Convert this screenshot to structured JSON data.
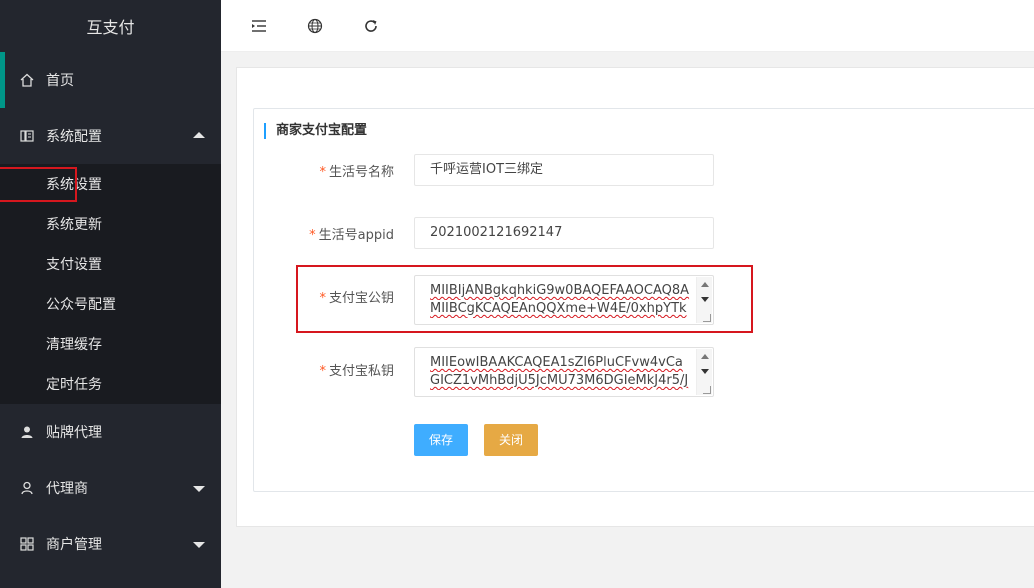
{
  "app": {
    "title": "互支付"
  },
  "sidebar": {
    "items": [
      {
        "label": "首页",
        "icon": "home-icon"
      },
      {
        "label": "系统配置",
        "icon": "system-config-icon",
        "expanded": true
      },
      {
        "label": "贴牌代理",
        "icon": "user-icon"
      },
      {
        "label": "代理商",
        "icon": "person-icon"
      },
      {
        "label": "商户管理",
        "icon": "grid-icon"
      }
    ],
    "submenu": [
      {
        "label": "系统设置"
      },
      {
        "label": "系统更新"
      },
      {
        "label": "支付设置"
      },
      {
        "label": "公众号配置"
      },
      {
        "label": "清理缓存"
      },
      {
        "label": "定时任务"
      }
    ]
  },
  "topbar": {
    "icons": [
      "menu-collapse-icon",
      "globe-icon",
      "refresh-icon"
    ]
  },
  "form": {
    "section_title": "商家支付宝配置",
    "required_mark": "*",
    "life_name_label": "生活号名称",
    "life_name_value": "千呼运营IOT三绑定",
    "appid_label": "生活号appid",
    "appid_value": "2021002121692147",
    "public_key_label": "支付宝公钥",
    "public_key_lines": [
      "MIIBIjANBgkqhkiG9w0BAQEFAAOCAQ8A",
      "MIIBCgKCAQEAnQQXme+W4E/0xhpYTk"
    ],
    "private_key_label": "支付宝私钥",
    "private_key_lines": [
      "MIIEowIBAAKCAQEA1sZl6PluCFvw4vCa",
      "GICZ1vMhBdjU5JcMU73M6DGIeMkJ4r5/J"
    ],
    "save_label": "保存",
    "close_label": "关闭"
  },
  "colors": {
    "sidebar_bg": "#23262e",
    "accent": "#009688",
    "save_button": "#1e9fff",
    "close_button": "#e5a53b",
    "annotation_red": "#d6171e"
  }
}
